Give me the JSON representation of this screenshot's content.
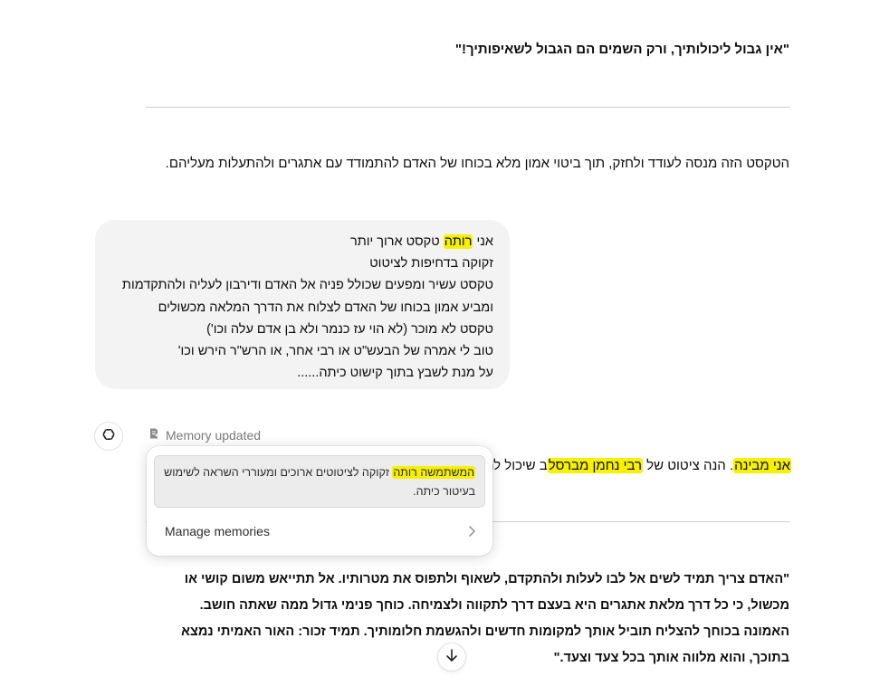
{
  "top_quote": "\"אין גבול ליכולותיך, ורק השמים הם הגבול לשאיפותיך!\"",
  "intro_paragraph": "הטקסט הזה מנסה לעודד ולחזק, תוך ביטוי אמון מלא בכוחו של האדם להתמודד עם אתגרים ולהתעלות מעליהם.",
  "user_message": {
    "line1_before": "אני ",
    "line1_highlight": "רותה",
    "line1_after": " טקסט ארוך יותר",
    "lines": [
      "זקוקה בדחיפות לציטוט",
      "טקסט עשיר ומפעים שכולל פניה אל האדם ודירבון לעליה ולהתקדמות",
      "ומביע אמון בכוחו של האדם לצלוח את הדרך המלאה מכשולים",
      "טקסט לא מוכר (לא הוי עז כנמר ולא בן אדם עלה וכו')",
      "טוב לי אמרה של הבעש\"ט או רבי אחר, או הרש\"ר הירש וכו'",
      "על מנת לשבץ בתוך קישוט כיתה......"
    ]
  },
  "memory_indicator": {
    "label": "Memory updated",
    "icon": "memory-icon"
  },
  "memory_popup": {
    "memory_text_highlight": "המשתמשה רותה",
    "memory_text_rest": " זקוקה לציטוטים ארוכים ומעוררי השראה לשימוש בעיטור כיתה.",
    "manage_label": "Manage memories"
  },
  "assistant_response": {
    "hl1": "אני מבינה",
    "part1": ". הנה ציטוט של ",
    "hl2": "רבי נחמן מברסל",
    "part2": "ב שיכול לה"
  },
  "big_quote": "\"האדם צריך תמיד לשים אל לבו לעלות ולהתקדם, לשאוף ולתפוס את מטרותיו. אל תתייאש משום קושי או מכשול, כי כל דרך מלאת אתגרים היא בעצם דרך לתקווה ולצמיחה. כוחך פנימי גדול ממה שאתה חושב. האמונה בכוחך להצליח תוביל אותך למקומות חדשים ולהגשמת חלומותיך. תמיד זכור: האור האמיתי נמצא בתוכך, והוא מלווה אותך בכל צעד וצעד.\"",
  "colors": {
    "highlight": "#f7f000",
    "bubble_bg": "#f3f3f3",
    "muted_text": "#7a7a7a"
  }
}
